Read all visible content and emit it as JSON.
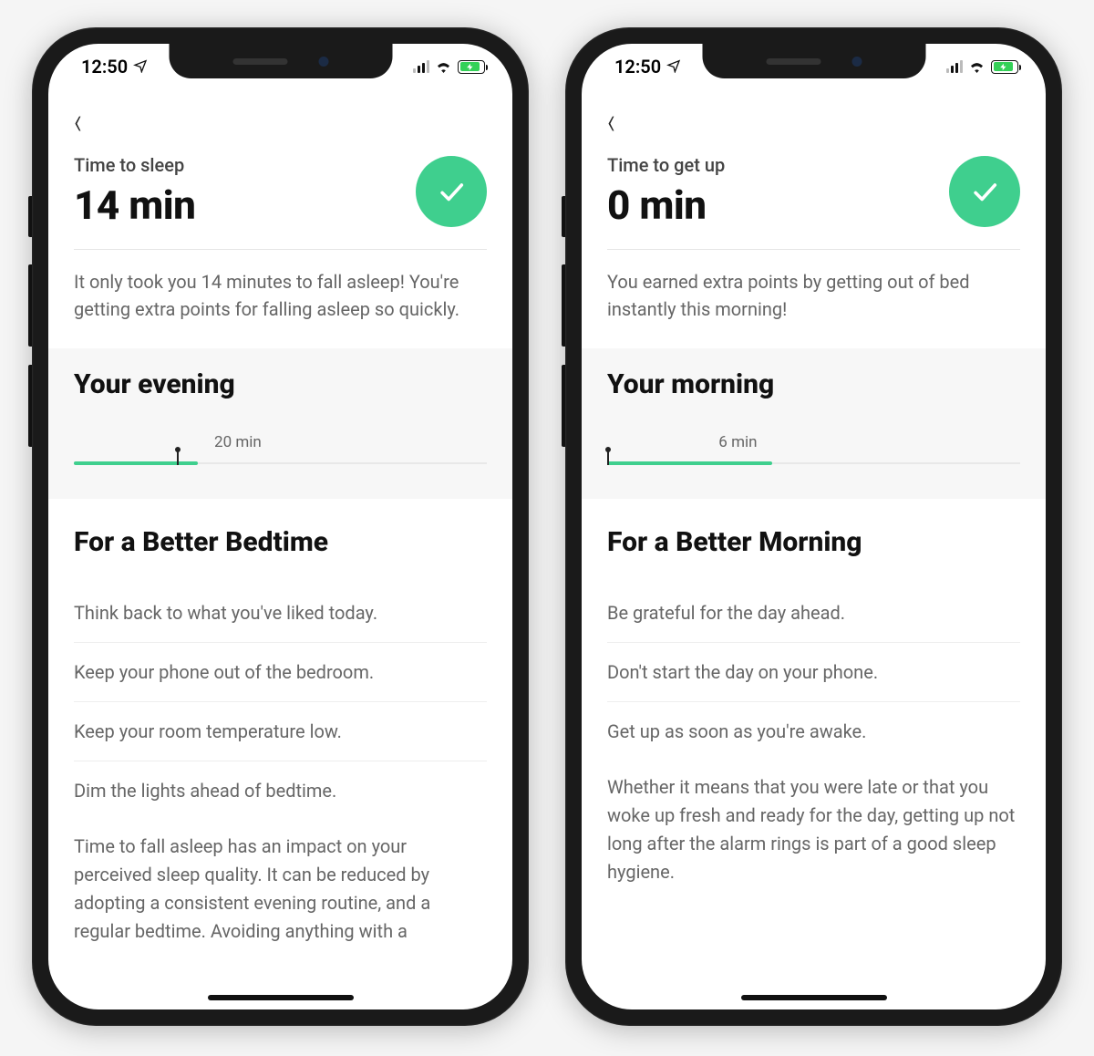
{
  "status": {
    "time": "12:50"
  },
  "colors": {
    "accent": "#3fcf8e"
  },
  "left": {
    "header": {
      "label": "Time to sleep",
      "value": "14 min"
    },
    "description": "It only took you 14 minutes to fall asleep! You're getting extra points for falling asleep so quickly.",
    "chart": {
      "title": "Your evening",
      "marker_label": "20 min",
      "fill_pct": 30,
      "marker_pct": 25,
      "label_left_pct": 34
    },
    "tips_title": "For a Better Bedtime",
    "tips": [
      "Think back to what you've liked today.",
      "Keep your phone out of the bedroom.",
      "Keep your room temperature low.",
      "Dim the lights ahead of bedtime."
    ],
    "long_text": "Time to fall asleep has an impact on your perceived sleep quality. It can be reduced by adopting a consistent evening routine, and a regular bedtime. Avoiding anything with a"
  },
  "right": {
    "header": {
      "label": "Time to get up",
      "value": "0 min"
    },
    "description": "You earned extra points by getting out of bed instantly this morning!",
    "chart": {
      "title": "Your morning",
      "marker_label": "6 min",
      "fill_pct": 40,
      "marker_pct": 0,
      "label_left_pct": 27
    },
    "tips_title": "For a Better Morning",
    "tips": [
      "Be grateful for the day ahead.",
      "Don't start the day on your phone.",
      "Get up as soon as you're awake."
    ],
    "long_text": "Whether it means that you were late or that you woke up fresh and ready for the day, getting up not long after the alarm rings is part of a good sleep hygiene."
  },
  "chart_data": [
    {
      "type": "bar",
      "title": "Your evening",
      "categories": [
        "Time to sleep"
      ],
      "values": [
        14
      ],
      "marker_minutes": 20,
      "xlabel": "",
      "ylabel": "",
      "unit": "min"
    },
    {
      "type": "bar",
      "title": "Your morning",
      "categories": [
        "Time to get up"
      ],
      "values": [
        0
      ],
      "marker_minutes": 6,
      "xlabel": "",
      "ylabel": "",
      "unit": "min"
    }
  ]
}
